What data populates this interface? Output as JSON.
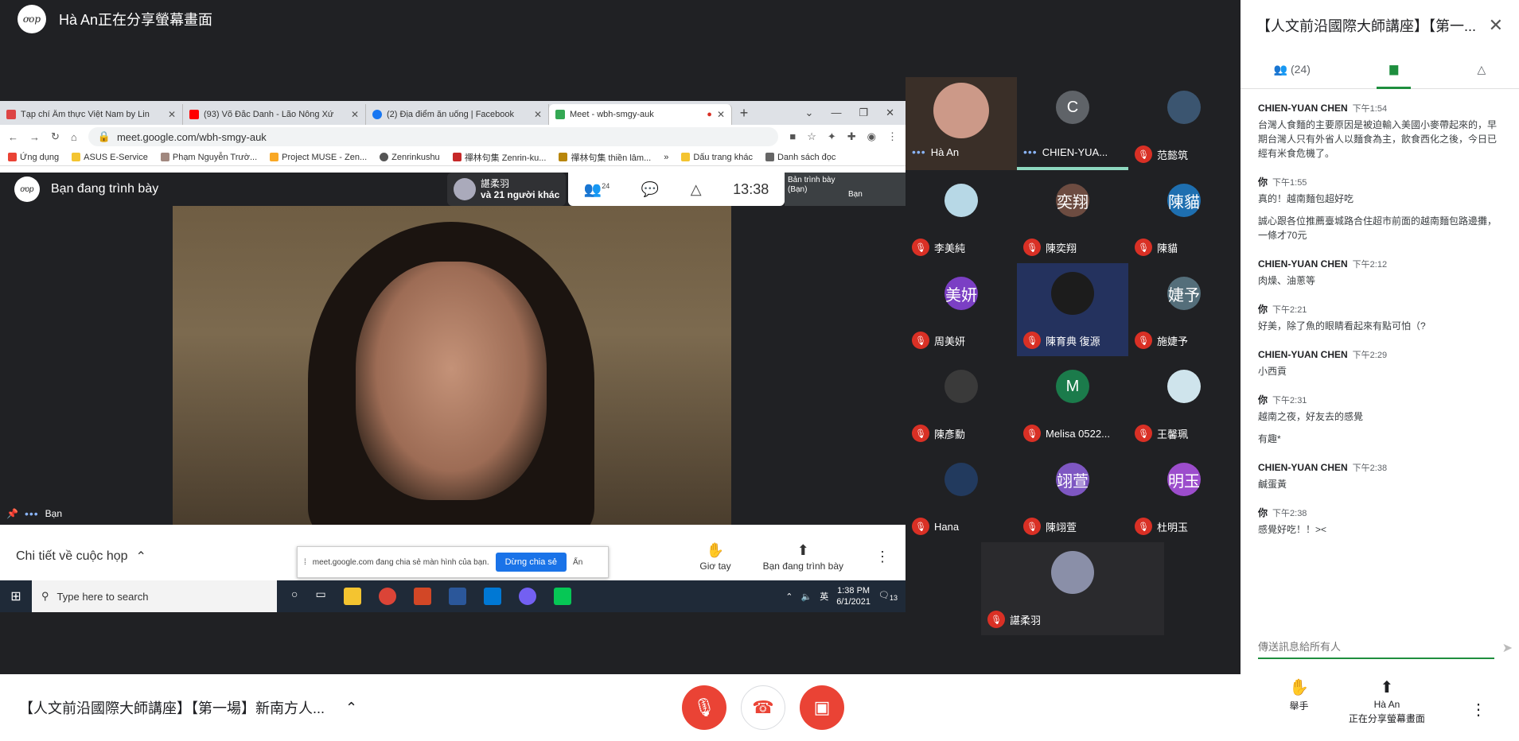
{
  "presenter": {
    "avatar_text": "ơop",
    "title": "Hà An正在分享螢幕畫面"
  },
  "browser": {
    "tabs": [
      {
        "label": "Tạp chí Ẩm thực Việt Nam by Lin",
        "color": "#d44"
      },
      {
        "label": "(93) Võ Đắc Danh - Lão Nông Xứ",
        "color": "#f00"
      },
      {
        "label": "(2) Địa điểm ăn uống | Facebook",
        "color": "#1877f2"
      },
      {
        "label": "Meet - wbh-smgy-auk",
        "color": "#34a853"
      }
    ],
    "url": "meet.google.com/wbh-smgy-auk",
    "bookmarks": [
      "Ứng dụng",
      "ASUS E-Service",
      "Phạm Nguyễn Trườ...",
      "Project MUSE - Zen...",
      "Zenrinkushu",
      "禪林句集 Zenrin-ku...",
      "禪林句集 thiền lâm...",
      "»",
      "Dấu trang khác",
      "Danh sách đọc"
    ]
  },
  "inner_meet": {
    "presenting": "Bạn đang trình bày",
    "pill_name": "諶柔羽",
    "pill_others": "và 21 người khác",
    "people_count": "24",
    "clock": "13:38",
    "self_label": "Bản trình bày (Bạn)",
    "self_name": "Bạn",
    "video_name": "Bạn",
    "details": "Chi tiết về cuộc họp",
    "raise_hand": "Giơ tay",
    "presenting_btn": "Bạn đang trình bày",
    "banner_text": "meet.google.com đang chia sẻ màn hình của bạn.",
    "banner_stop": "Dừng chia sẻ",
    "banner_hide": "Ẩn"
  },
  "taskbar": {
    "search": "Type here to search",
    "time": "1:38 PM",
    "date": "6/1/2021",
    "ime": "英",
    "notif": "13"
  },
  "participants": [
    {
      "name": "Hà An",
      "initial": "",
      "color": "#c98",
      "muted": false
    },
    {
      "name": "CHIEN-YUA...",
      "initial": "C",
      "color": "#5f6368",
      "muted": false
    },
    {
      "name": "范懿筑",
      "initial": "",
      "color": "#3b5570",
      "muted": true
    },
    {
      "name": "李美純",
      "initial": "",
      "color": "#b7d8e6",
      "muted": true
    },
    {
      "name": "陳奕翔",
      "initial": "奕翔",
      "color": "#6d4c41",
      "muted": true
    },
    {
      "name": "陳貓",
      "initial": "陳貓",
      "color": "#1e6fb0",
      "muted": true
    },
    {
      "name": "周美妍",
      "initial": "美妍",
      "color": "#7b3fc4",
      "muted": true
    },
    {
      "name": "陳育典 復源",
      "initial": "",
      "color": "#1c1c1c",
      "muted": true
    },
    {
      "name": "施婕予",
      "initial": "婕予",
      "color": "#546e7a",
      "muted": true
    },
    {
      "name": "陳彥勳",
      "initial": "",
      "color": "#3a3a3a",
      "muted": true
    },
    {
      "name": "Melisa 0522...",
      "initial": "M",
      "color": "#1b7b4b",
      "muted": true
    },
    {
      "name": "王馨珮",
      "initial": "",
      "color": "#cfe4ec",
      "muted": true
    },
    {
      "name": "Hana",
      "initial": "",
      "color": "#223a5e",
      "muted": true
    },
    {
      "name": "陳翊萱",
      "initial": "翊萱",
      "color": "#7e57c2",
      "muted": true
    },
    {
      "name": "杜明玉",
      "initial": "明玉",
      "color": "#9c4dcc",
      "muted": true
    },
    {
      "name": "諶柔羽",
      "initial": "",
      "color": "#8a8fa8",
      "muted": true
    }
  ],
  "panel": {
    "title": "【人文前沿國際大師講座】【第一...",
    "people_count": "(24)",
    "messages": [
      {
        "who": "CHIEN-YUAN CHEN",
        "time": "下午1:54",
        "texts": [
          "台灣人食麵的主要原因是被迫輸入美國小麥帶起來的，早期台灣人只有外省人以麵食為主，飲食西化之後，今日已經有米食危機了。"
        ]
      },
      {
        "who": "你",
        "time": "下午1:55",
        "texts": [
          "真的！越南麵包超好吃",
          "誠心跟各位推薦臺城路合住超市前面的越南麵包路邊攤，一條才70元"
        ]
      },
      {
        "who": "CHIEN-YUAN CHEN",
        "time": "下午2:12",
        "texts": [
          "肉燥、油蔥等"
        ]
      },
      {
        "who": "你",
        "time": "下午2:21",
        "texts": [
          "好美，除了魚的眼睛看起來有點可怕（?"
        ]
      },
      {
        "who": "CHIEN-YUAN CHEN",
        "time": "下午2:29",
        "texts": [
          "小西貢"
        ]
      },
      {
        "who": "你",
        "time": "下午2:31",
        "texts": [
          "越南之夜，好友去的感覺",
          "有趣*"
        ]
      },
      {
        "who": "CHIEN-YUAN CHEN",
        "time": "下午2:38",
        "texts": [
          "鹹蛋黃"
        ]
      },
      {
        "who": "你",
        "time": "下午2:38",
        "texts": [
          "感覺好吃！！><"
        ]
      }
    ],
    "input_placeholder": "傳送訊息給所有人"
  },
  "bottom": {
    "title": "【人文前沿國際大師講座】【第一場】新南方人...",
    "raise_hand": "舉手",
    "presenter_line1": "Hà An",
    "presenter_line2": "正在分享螢幕畫面"
  }
}
